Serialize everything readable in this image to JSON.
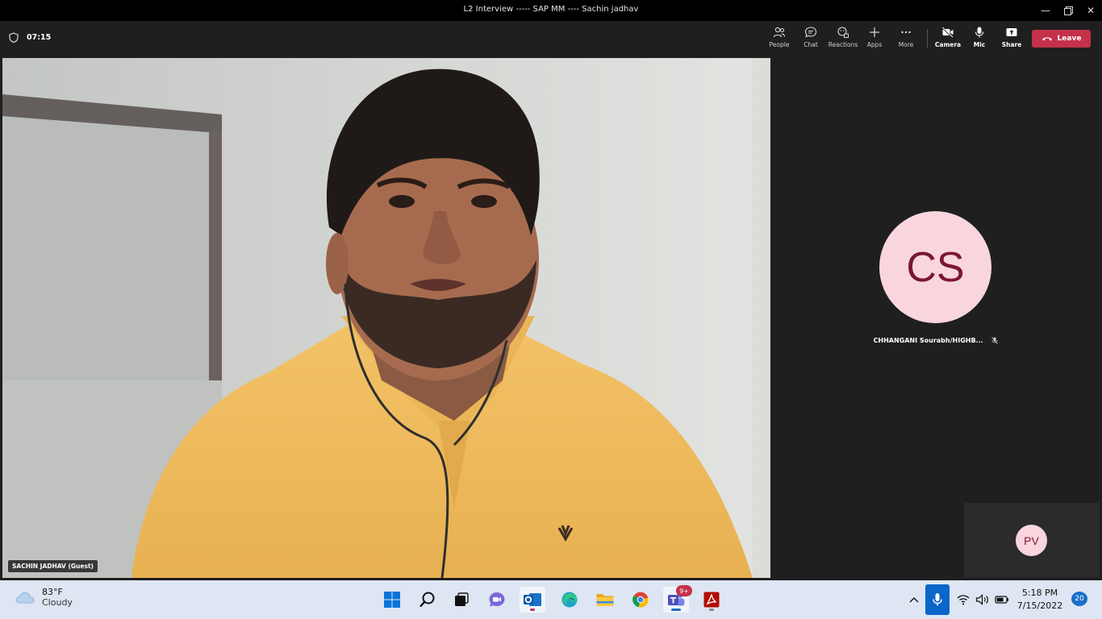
{
  "window": {
    "title": "L2 Interview ----- SAP MM ---- Sachin jadhav"
  },
  "meeting": {
    "timer": "07:15",
    "toolbar": {
      "people": "People",
      "chat": "Chat",
      "reactions": "Reactions",
      "apps": "Apps",
      "more": "More",
      "camera": "Camera",
      "mic": "Mic",
      "share": "Share",
      "leave": "Leave"
    },
    "main_video": {
      "name": "SACHIN JADHAV (Guest)"
    },
    "participants": [
      {
        "initials": "CS",
        "name": "CHHANGANI Sourabh/HIGHB..."
      },
      {
        "initials": "PV"
      }
    ]
  },
  "taskbar": {
    "weather": {
      "temp": "83°F",
      "condition": "Cloudy"
    },
    "teams_badge": "9+",
    "clock": {
      "time": "5:18 PM",
      "date": "7/15/2022"
    },
    "notifications": "20"
  },
  "colors": {
    "leave": "#c4314b",
    "avatar_bg": "#f9d6de",
    "avatar_fg": "#7a1634",
    "shirt": "#f0bd5a"
  }
}
